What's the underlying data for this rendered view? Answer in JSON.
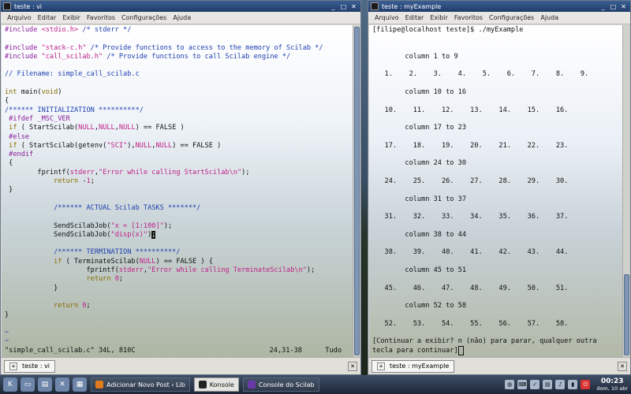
{
  "left_window": {
    "title": "teste : vi",
    "menu": [
      "Arquivo",
      "Editar",
      "Exibir",
      "Favoritos",
      "Configurações",
      "Ajuda"
    ],
    "tab_label": "teste : vi",
    "lines": [
      [
        {
          "t": "#include ",
          "c": "pre"
        },
        {
          "t": "<stdio.h>",
          "c": "str"
        },
        {
          "t": " /* stderr */",
          "c": "com"
        }
      ],
      [],
      [
        {
          "t": "#include ",
          "c": "pre"
        },
        {
          "t": "\"stack-c.h\"",
          "c": "str"
        },
        {
          "t": " /* Provide functions to access to the memory of Scilab */",
          "c": "com"
        }
      ],
      [
        {
          "t": "#include ",
          "c": "pre"
        },
        {
          "t": "\"call_scilab.h\"",
          "c": "str"
        },
        {
          "t": " /* Provide functions to call Scilab engine */",
          "c": "com"
        }
      ],
      [],
      [
        {
          "t": "// Filename: simple_call_scilab.c",
          "c": "com"
        }
      ],
      [],
      [
        {
          "t": "int",
          "c": "kw"
        },
        {
          "t": " main(",
          "c": "fn"
        },
        {
          "t": "void",
          "c": "kw"
        },
        {
          "t": ")",
          "c": "fn"
        }
      ],
      [
        {
          "t": "{",
          "c": "fn"
        }
      ],
      [
        {
          "t": "/****** INITIALIZATION **********/",
          "c": "com"
        }
      ],
      [
        {
          "t": " #ifdef _MSC_VER",
          "c": "pre"
        }
      ],
      [
        {
          "t": " if",
          "c": "kw"
        },
        {
          "t": " ( StartScilab(",
          "c": "fn"
        },
        {
          "t": "NULL",
          "c": "str"
        },
        {
          "t": ",",
          "c": "fn"
        },
        {
          "t": "NULL",
          "c": "str"
        },
        {
          "t": ",",
          "c": "fn"
        },
        {
          "t": "NULL",
          "c": "str"
        },
        {
          "t": ") == FALSE )",
          "c": "fn"
        }
      ],
      [
        {
          "t": " #else",
          "c": "pre"
        }
      ],
      [
        {
          "t": " if",
          "c": "kw"
        },
        {
          "t": " ( StartScilab(getenv(",
          "c": "fn"
        },
        {
          "t": "\"SCI\"",
          "c": "str"
        },
        {
          "t": "),",
          "c": "fn"
        },
        {
          "t": "NULL",
          "c": "str"
        },
        {
          "t": ",",
          "c": "fn"
        },
        {
          "t": "NULL",
          "c": "str"
        },
        {
          "t": ") == FALSE )",
          "c": "fn"
        }
      ],
      [
        {
          "t": " #endif",
          "c": "pre"
        }
      ],
      [
        {
          "t": " {",
          "c": "fn"
        }
      ],
      [
        {
          "t": "        fprintf(",
          "c": "fn"
        },
        {
          "t": "stderr",
          "c": "str"
        },
        {
          "t": ",",
          "c": "fn"
        },
        {
          "t": "\"Error while calling StartScilab\\n\"",
          "c": "str"
        },
        {
          "t": ");",
          "c": "fn"
        }
      ],
      [
        {
          "t": "            ",
          "c": "fn"
        },
        {
          "t": "return",
          "c": "kw"
        },
        {
          "t": " -",
          "c": "fn"
        },
        {
          "t": "1",
          "c": "str"
        },
        {
          "t": ";",
          "c": "fn"
        }
      ],
      [
        {
          "t": " }",
          "c": "fn"
        }
      ],
      [],
      [
        {
          "t": "            /****** ACTUAL Scilab TASKS *******/",
          "c": "com"
        }
      ],
      [],
      [
        {
          "t": "            SendScilabJob(",
          "c": "fn"
        },
        {
          "t": "\"x = [1:100]\"",
          "c": "str"
        },
        {
          "t": ");",
          "c": "fn"
        }
      ],
      [
        {
          "t": "            SendScilabJob(",
          "c": "fn"
        },
        {
          "t": "\"disp(x)\"",
          "c": "str"
        },
        {
          "t": ")",
          "c": "fn"
        },
        {
          "t": ";",
          "c": "cur"
        }
      ],
      [],
      [
        {
          "t": "            /****** TERMINATION **********/",
          "c": "com"
        }
      ],
      [
        {
          "t": "            ",
          "c": "fn"
        },
        {
          "t": "if",
          "c": "kw"
        },
        {
          "t": " ( TerminateScilab(",
          "c": "fn"
        },
        {
          "t": "NULL",
          "c": "str"
        },
        {
          "t": ") == FALSE ) {",
          "c": "fn"
        }
      ],
      [
        {
          "t": "                    fprintf(",
          "c": "fn"
        },
        {
          "t": "stderr",
          "c": "str"
        },
        {
          "t": ",",
          "c": "fn"
        },
        {
          "t": "\"Error while calling TerminateScilab\\n\"",
          "c": "str"
        },
        {
          "t": ");",
          "c": "fn"
        }
      ],
      [
        {
          "t": "                    ",
          "c": "fn"
        },
        {
          "t": "return",
          "c": "kw"
        },
        {
          "t": " ",
          "c": "fn"
        },
        {
          "t": "0",
          "c": "str"
        },
        {
          "t": ";",
          "c": "fn"
        }
      ],
      [
        {
          "t": "            }",
          "c": "fn"
        }
      ],
      [],
      [
        {
          "t": "            ",
          "c": "fn"
        },
        {
          "t": "return",
          "c": "kw"
        },
        {
          "t": " ",
          "c": "fn"
        },
        {
          "t": "0",
          "c": "str"
        },
        {
          "t": ";",
          "c": "fn"
        }
      ],
      [
        {
          "t": "}",
          "c": "fn"
        }
      ],
      [],
      [
        {
          "t": "~",
          "c": "tilde"
        }
      ],
      [
        {
          "t": "~",
          "c": "tilde"
        }
      ]
    ],
    "status_file": "\"simple_call_scilab.c\" 34L, 810C",
    "status_pos": "24,31-38",
    "status_all": "Tudo"
  },
  "right_window": {
    "title": "teste : myExample",
    "menu": [
      "Arquivo",
      "Editar",
      "Exibir",
      "Favoritos",
      "Configurações",
      "Ajuda"
    ],
    "tab_label": "teste : myExample",
    "lines": [
      "[filipe@localhost teste]$ ./myExample",
      "",
      "",
      "        column 1 to 9",
      "",
      "   1.    2.    3.    4.    5.    6.    7.    8.    9.",
      "",
      "        column 10 to 16",
      "",
      "   10.    11.    12.    13.    14.    15.    16.",
      "",
      "        column 17 to 23",
      "",
      "   17.    18.    19.    20.    21.    22.    23.",
      "",
      "        column 24 to 30",
      "",
      "   24.    25.    26.    27.    28.    29.    30.",
      "",
      "        column 31 to 37",
      "",
      "   31.    32.    33.    34.    35.    36.    37.",
      "",
      "        column 38 to 44",
      "",
      "   38.    39.    40.    41.    42.    43.    44.",
      "",
      "        column 45 to 51",
      "",
      "   45.    46.    47.    48.    49.    50.    51.",
      "",
      "        column 52 to 58",
      "",
      "   52.    53.    54.    55.    56.    57.    58.",
      "",
      "[Continuar a exibir? n (não) para parar, qualquer outra",
      "tecla para continuar]"
    ]
  },
  "taskbar": {
    "tasks": [
      {
        "label": "Adicionar Novo Post ‹ Lib",
        "active": false
      },
      {
        "label": "Konsole",
        "active": true
      },
      {
        "label": "Console do Scilab",
        "active": false
      }
    ],
    "clock_time": "00:23",
    "clock_date": "dom, 10 abr"
  },
  "colors": {
    "titlebar": "#203d6b",
    "preprocessor": "#8a1f9a",
    "string": "#c01f8a",
    "comment": "#1f3fb0",
    "keyword": "#8a6a00"
  }
}
